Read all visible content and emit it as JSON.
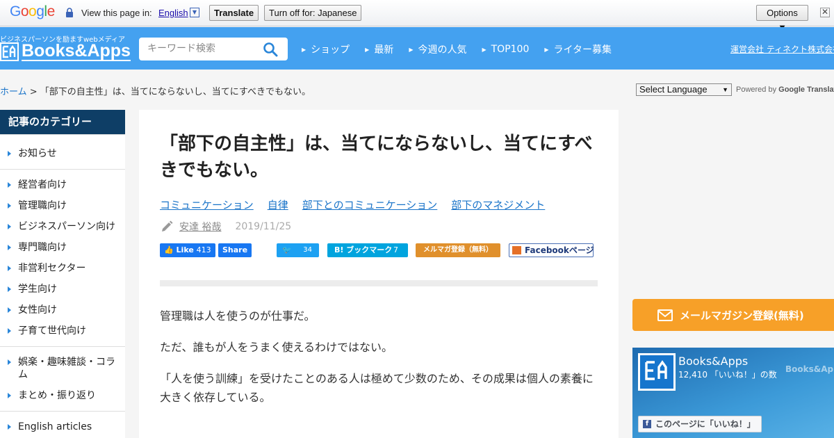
{
  "translate_bar": {
    "logo_letters": [
      "G",
      "o",
      "o",
      "g",
      "l",
      "e"
    ],
    "logo_colors": [
      "#4285f4",
      "#ea4335",
      "#fbbc05",
      "#4285f4",
      "#34a853",
      "#ea4335"
    ],
    "view_text": "View this page in:",
    "language": "English",
    "translate_label": "Translate",
    "turn_off_label": "Turn off for: Japanese",
    "options_label": "Options ▼",
    "close_label": "✕"
  },
  "header": {
    "tagline": "ビジネスパーソンを励ますwebメディア",
    "brand": "Books&Apps",
    "search_placeholder": "キーワード検索",
    "nav": [
      "ショップ",
      "最新",
      "今週の人気",
      "TOP100",
      "ライター募集"
    ],
    "company": "運営会社 ティネクト株式会社"
  },
  "breadcrumb": {
    "home": "ホーム",
    "separator": " > ",
    "current": "「部下の自主性」は、当てにならないし、当てにすべきでもない。"
  },
  "translate_widget": {
    "select_label": "Select Language",
    "powered_by": "Powered by",
    "google": "Google",
    "translate": "Translate"
  },
  "sidebar": {
    "heading": "記事のカテゴリー",
    "items": [
      "お知らせ",
      "経営者向け",
      "管理職向け",
      "ビジネスパーソン向け",
      "専門職向け",
      "非営利セクター",
      "学生向け",
      "女性向け",
      "子育て世代向け",
      "娯楽・趣味雑談・コラム",
      "まとめ・振り返り",
      "English articles"
    ]
  },
  "article": {
    "title": "「部下の自主性」は、当てにならないし、当てにすべきでもない。",
    "tags": [
      "コミュニケーション",
      "自律",
      "部下とのコミュニケーション",
      "部下のマネジメント"
    ],
    "author": "安達 裕哉",
    "date": "2019/11/25",
    "social": {
      "fb_like": "Like",
      "fb_like_count": "413",
      "fb_share": "Share",
      "twitter_count": "34",
      "hatena": "ブックマーク",
      "hatena_count": "7",
      "mailmag": "メルマガ登録（無料）",
      "fb_page": "Facebookページ"
    },
    "paragraphs": [
      "管理職は人を使うのが仕事だ。",
      "ただ、誰もが人をうまく使えるわけではない。",
      "「人を使う訓練」を受けたことのある人は極めて少数のため、その成果は個人の素養に大きく依存している。"
    ]
  },
  "right": {
    "mail_button": "メールマガジン登録(無料)",
    "fb_widget": {
      "name": "Books&Apps",
      "count": "12,410 「いいね！」の数",
      "watermark": "Books&Apps",
      "like_button": "このページに「いいね！」"
    }
  }
}
